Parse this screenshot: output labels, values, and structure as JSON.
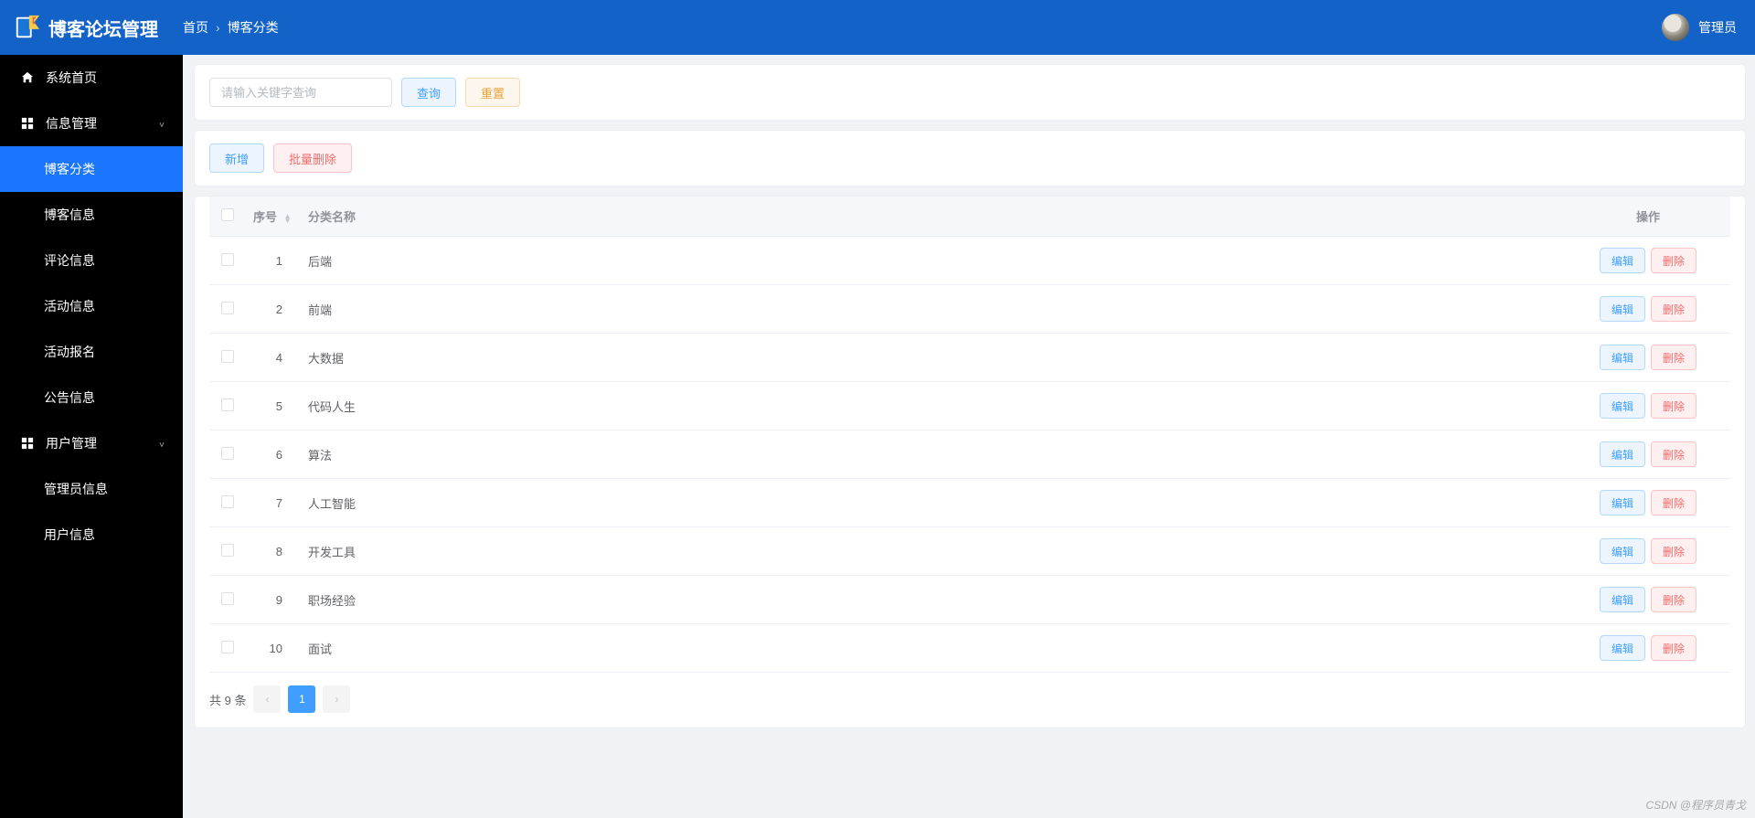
{
  "header": {
    "app_title": "博客论坛管理",
    "breadcrumb": {
      "home": "首页",
      "current": "博客分类"
    },
    "user_name": "管理员"
  },
  "sidebar": {
    "home": "系统首页",
    "group_info": {
      "label": "信息管理",
      "items": [
        "博客分类",
        "博客信息",
        "评论信息",
        "活动信息",
        "活动报名",
        "公告信息"
      ],
      "active_index": 0
    },
    "group_user": {
      "label": "用户管理",
      "items": [
        "管理员信息",
        "用户信息"
      ]
    }
  },
  "toolbar": {
    "search_placeholder": "请输入关键字查询",
    "query_label": "查询",
    "reset_label": "重置",
    "add_label": "新增",
    "batch_delete_label": "批量删除"
  },
  "table": {
    "col_index": "序号",
    "col_name": "分类名称",
    "col_ops": "操作",
    "edit_label": "编辑",
    "delete_label": "删除",
    "rows": [
      {
        "idx": "1",
        "name": "后端"
      },
      {
        "idx": "2",
        "name": "前端"
      },
      {
        "idx": "4",
        "name": "大数据"
      },
      {
        "idx": "5",
        "name": "代码人生"
      },
      {
        "idx": "6",
        "name": "算法"
      },
      {
        "idx": "7",
        "name": "人工智能"
      },
      {
        "idx": "8",
        "name": "开发工具"
      },
      {
        "idx": "9",
        "name": "职场经验"
      },
      {
        "idx": "10",
        "name": "面试"
      }
    ]
  },
  "pagination": {
    "total_text": "共 9 条",
    "pages": [
      "1"
    ],
    "current": "1"
  },
  "watermark": "CSDN @程序员青戈"
}
